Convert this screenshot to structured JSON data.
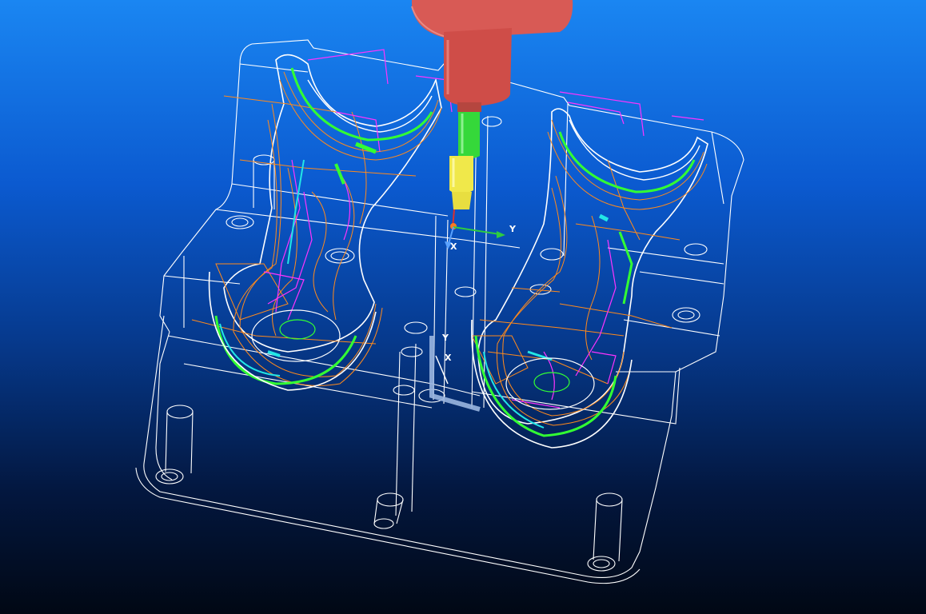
{
  "view": {
    "background_top": "#1a86f2",
    "background_bottom": "#010814",
    "wireframe_color": "#ffffff",
    "toolpath_colors": [
      "#ff8a1c",
      "#ff33ff",
      "#33ff33",
      "#22e6e6",
      "#d14cff"
    ]
  },
  "tool": {
    "holder_color": "#d85a55",
    "shank_color": "#35d83a",
    "tip_color": "#f0e84a"
  },
  "triad_primary": {
    "x_label": "X",
    "y_label": "Y"
  },
  "triad_secondary": {
    "x_label": "X",
    "y_label": "Y"
  }
}
